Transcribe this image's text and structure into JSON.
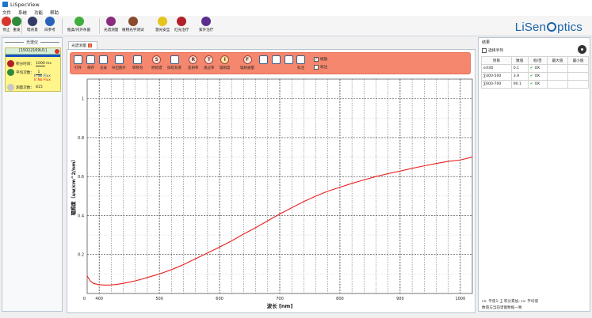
{
  "window": {
    "title": "LiSpecView"
  },
  "menu": [
    "文件",
    "系统",
    "功能",
    "帮助"
  ],
  "toolbar": [
    {
      "label": "停止",
      "icon": "stop-icon",
      "color": "#d9342b"
    },
    {
      "label": "重发",
      "icon": "resend-icon",
      "color": "#2f8a3a"
    },
    {
      "label": "暗背景",
      "icon": "dark-background-icon",
      "color": "#333a66"
    },
    {
      "label": "白参考",
      "icon": "white-reference-icon",
      "color": "#2a62b8"
    },
    {
      "label": "瓶类/闪外杀菌",
      "icon": "uv-sterilize-icon",
      "color": "#3fae3a"
    },
    {
      "label": "光谱测量",
      "icon": "spectrum-measure-icon",
      "color": "#8a2b7e"
    },
    {
      "label": "植物光学测试",
      "icon": "plant-light-icon",
      "color": "#8a4b2e"
    },
    {
      "label": "激光安全",
      "icon": "laser-safety-icon",
      "color": "#e6c419"
    },
    {
      "label": "红光治疗",
      "icon": "red-light-therapy-icon",
      "color": "#b21f2a"
    },
    {
      "label": "紫外治疗",
      "icon": "uv-therapy-icon",
      "color": "#5b2d8e"
    }
  ],
  "logo": {
    "text_before": "LiSen",
    "text_after": "ptics"
  },
  "left_panel": {
    "header": "光谱仪",
    "device_id": "[15022169U1]",
    "rows": [
      {
        "label": "积分时间：",
        "value": "1000",
        "unit": "ms"
      },
      {
        "label": "平均次数：",
        "value": "1",
        "extra_blue": "Ir:No Flux",
        "extra_red": "Ir:No Flux"
      },
      {
        "label": "测量次数：",
        "value": "815"
      }
    ]
  },
  "tab": {
    "label": "光谱测量"
  },
  "chart_tools": [
    {
      "label": "打开",
      "glyph": "",
      "icon": "open-icon"
    },
    {
      "label": "保存",
      "glyph": "",
      "icon": "save-icon"
    },
    {
      "label": "记录",
      "glyph": "",
      "icon": "record-icon"
    },
    {
      "label": "导出图片",
      "glyph": "",
      "icon": "export-image-icon"
    },
    {
      "label": "转移为",
      "glyph": "",
      "icon": "transfer-icon"
    },
    {
      "label": "原始谱",
      "glyph": "S",
      "icon": "raw-spectrum-icon"
    },
    {
      "label": "扣暗背景",
      "glyph": "",
      "icon": "subtract-dark-icon"
    },
    {
      "label": "反射率",
      "glyph": "R",
      "icon": "reflectance-icon"
    },
    {
      "label": "透过率",
      "glyph": "T",
      "icon": "transmittance-icon"
    },
    {
      "label": "辐照度",
      "glyph": "I",
      "icon": "irradiance-icon"
    },
    {
      "label": "辐射通量",
      "glyph": "F",
      "icon": "radiant-flux-icon"
    },
    {
      "label": "",
      "glyph": "",
      "icon": "vertical-scale-icon"
    },
    {
      "label": "",
      "glyph": "",
      "icon": "fit-icon"
    },
    {
      "label": "",
      "glyph": "",
      "icon": "zoom-box-icon"
    },
    {
      "label": "标注",
      "glyph": "",
      "icon": "annotate-list-icon"
    }
  ],
  "chart_checks": [
    {
      "label": "缩放",
      "checked": true
    },
    {
      "label": "标注",
      "checked": false
    }
  ],
  "chart_data": {
    "type": "line",
    "title": "",
    "xlabel": "波长 [nm]",
    "ylabel": "辐照度（uw/cm^2/nm）",
    "xlim": [
      380,
      1020
    ],
    "ylim": [
      0,
      1.1
    ],
    "xticks": [
      400,
      500,
      600,
      700,
      800,
      900,
      1000
    ],
    "yticks": [
      0.2,
      0.4,
      0.6,
      0.8,
      1.0
    ],
    "ytick_labels": [
      "0.2",
      "0.4",
      "0.6",
      "0.8",
      "1"
    ],
    "grid": true,
    "series": [
      {
        "color": "#e8201f",
        "x": [
          380,
          385,
          390,
          400,
          410,
          420,
          430,
          440,
          450,
          460,
          470,
          480,
          490,
          500,
          520,
          540,
          560,
          580,
          600,
          620,
          640,
          660,
          680,
          700,
          720,
          740,
          760,
          780,
          800,
          820,
          840,
          860,
          880,
          900,
          920,
          940,
          960,
          980,
          1000,
          1020
        ],
        "y": [
          0.09,
          0.065,
          0.052,
          0.045,
          0.043,
          0.044,
          0.047,
          0.052,
          0.058,
          0.065,
          0.073,
          0.082,
          0.091,
          0.1,
          0.122,
          0.148,
          0.178,
          0.208,
          0.238,
          0.27,
          0.305,
          0.338,
          0.373,
          0.408,
          0.44,
          0.472,
          0.5,
          0.525,
          0.545,
          0.565,
          0.583,
          0.6,
          0.615,
          0.628,
          0.642,
          0.655,
          0.667,
          0.678,
          0.685,
          0.7
        ]
      }
    ]
  },
  "results": {
    "group_label": "结果",
    "check_label": "选择手列",
    "columns": [
      "项目",
      "数值",
      "标/否",
      "最大值",
      "最小值"
    ],
    "rows": [
      {
        "item": "ert40",
        "value": "0.1",
        "status": "OK"
      },
      {
        "item": "∑400-500",
        "value": "3.9",
        "status": "OK"
      },
      {
        "item": "∑600-700",
        "value": "90.1",
        "status": "OK"
      }
    ],
    "footer1": "cx: 平值1; ∑ 积分累加; cv: 平均值",
    "footer2": "数值与当前谱图数据一致"
  }
}
